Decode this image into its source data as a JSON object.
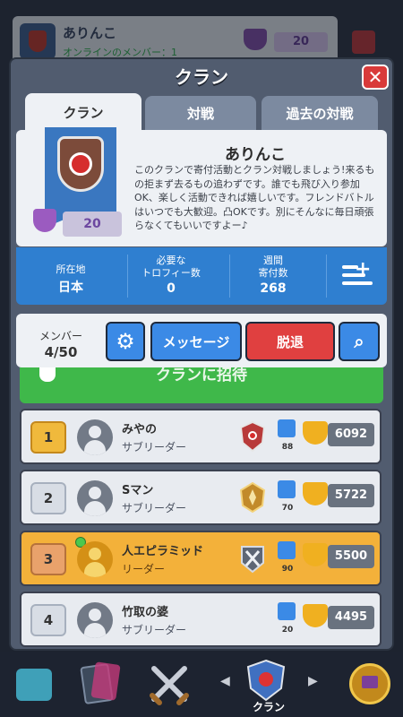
{
  "background_card": {
    "name": "ありんこ",
    "subtitle": "オンラインのメンバー：1",
    "trophies": "20"
  },
  "panel": {
    "title": "クラン",
    "close_icon": "close-x-icon"
  },
  "tabs": [
    {
      "label": "クラン",
      "active": true
    },
    {
      "label": "対戦",
      "active": false
    },
    {
      "label": "過去の対戦",
      "active": false
    }
  ],
  "clan": {
    "name": "ありんこ",
    "description": "このクランで寄付活動とクラン対戦しましょう!来るもの拒まず去るもの追わずです。誰でも飛び入り参加OK、楽しく活動できれば嬉しいです。フレンドバトルはいつでも大歓迎。凸OKです。別にそんなに毎日頑張らなくてもいいですよー♪",
    "trophies": "20"
  },
  "stats": {
    "location_label": "所在地",
    "location_value": "日本",
    "required_label_1": "必要な",
    "required_label_2": "トロフィー数",
    "required_value": "0",
    "weekly_label_1": "週間",
    "weekly_label_2": "寄付数",
    "weekly_value": "268",
    "list_icon": "list-add-icon"
  },
  "members_bar": {
    "label": "メンバー",
    "count": "4/50",
    "message_button": "メッセージ",
    "leave_button": "脱退",
    "invite_button": "クランに招待"
  },
  "members": [
    {
      "rank": "1",
      "name": "みやの",
      "role": "サブリーダー",
      "donations": "88",
      "trophies": "6092",
      "badge": "red-shield"
    },
    {
      "rank": "2",
      "name": "Sマン",
      "role": "サブリーダー",
      "donations": "70",
      "trophies": "5722",
      "badge": "gold-emblem"
    },
    {
      "rank": "3",
      "name": "人エピラミッド",
      "role": "リーダー",
      "donations": "90",
      "trophies": "5500",
      "badge": "silver-swords"
    },
    {
      "rank": "4",
      "name": "竹取の婆",
      "role": "サブリーダー",
      "donations": "20",
      "trophies": "4495",
      "badge": ""
    }
  ],
  "nav": {
    "clan_label": "クラン",
    "left_arrow": "◀",
    "right_arrow": "▶"
  },
  "colors": {
    "accent_blue": "#3b8ae6",
    "leave_red": "#e04040",
    "invite_green": "#3fb84a",
    "highlight_row": "#f3b13a"
  }
}
